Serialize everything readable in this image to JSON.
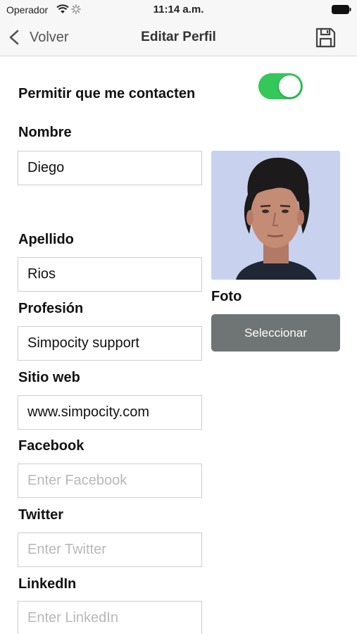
{
  "status_bar": {
    "carrier": "Operador",
    "time": "11:14 a.m."
  },
  "nav": {
    "back_label": "Volver",
    "title": "Editar Perfil",
    "save_icon": "floppy-disk-icon"
  },
  "form": {
    "allow_contact_label": "Permitir que me contacten",
    "allow_contact_enabled": true,
    "toggle_color": "#34c759",
    "nombre": {
      "label": "Nombre",
      "value": "Diego"
    },
    "apellido": {
      "label": "Apellido",
      "value": "Rios"
    },
    "profesion": {
      "label": "Profesión",
      "value": "Simpocity support"
    },
    "sitio_web": {
      "label": "Sitio web",
      "value": "www.simpocity.com"
    },
    "facebook": {
      "label": "Facebook",
      "value": "",
      "placeholder": "Enter Facebook"
    },
    "twitter": {
      "label": "Twitter",
      "value": "",
      "placeholder": "Enter Twitter"
    },
    "linkedin": {
      "label": "LinkedIn",
      "value": "",
      "placeholder": "Enter LinkedIn"
    }
  },
  "photo": {
    "caption": "Foto",
    "select_label": "Seleccionar",
    "button_color": "#6f7574"
  }
}
